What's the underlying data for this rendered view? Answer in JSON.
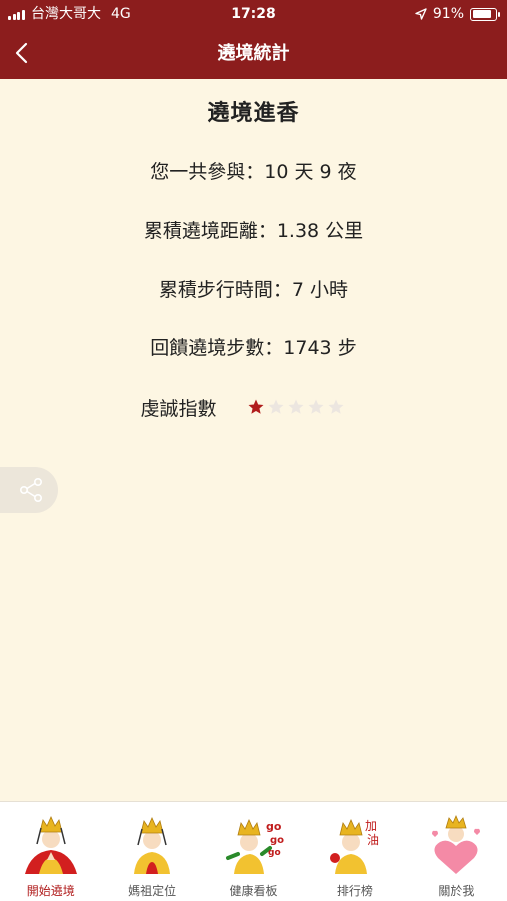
{
  "status_bar": {
    "carrier": "台灣大哥大",
    "network": "4G",
    "time": "17:28",
    "battery": "91%",
    "battery_level": 0.91
  },
  "nav": {
    "title": "遶境統計",
    "back_icon": "chevron-left-icon"
  },
  "content": {
    "title": "遶境進香",
    "stats": [
      "您一共參與：10 天 9 夜",
      "累積遶境距離：1.38 公里",
      "累積步行時間：7 小時",
      "回饋遶境步數：1743 步"
    ],
    "rating": {
      "label": "虔誠指數",
      "filled": 1,
      "total": 5
    }
  },
  "share_icon": "share-icon",
  "tabs": [
    {
      "label": "開始遶境",
      "icon": "mazu-praying-icon",
      "active": true
    },
    {
      "label": "媽祖定位",
      "icon": "mazu-seated-icon",
      "active": false
    },
    {
      "label": "健康看板",
      "icon": "mazu-gogogo-icon",
      "badge": "go go go",
      "active": false
    },
    {
      "label": "排行榜",
      "icon": "mazu-cheer-icon",
      "badge": "加油",
      "active": false
    },
    {
      "label": "關於我",
      "icon": "mazu-heart-icon",
      "active": false
    }
  ],
  "colors": {
    "brand": "#8c1d1d",
    "background": "#fdf6e3",
    "star_filled": "#b01c1c",
    "star_empty": "#ece6e0",
    "active_tab": "#b01c1c"
  }
}
